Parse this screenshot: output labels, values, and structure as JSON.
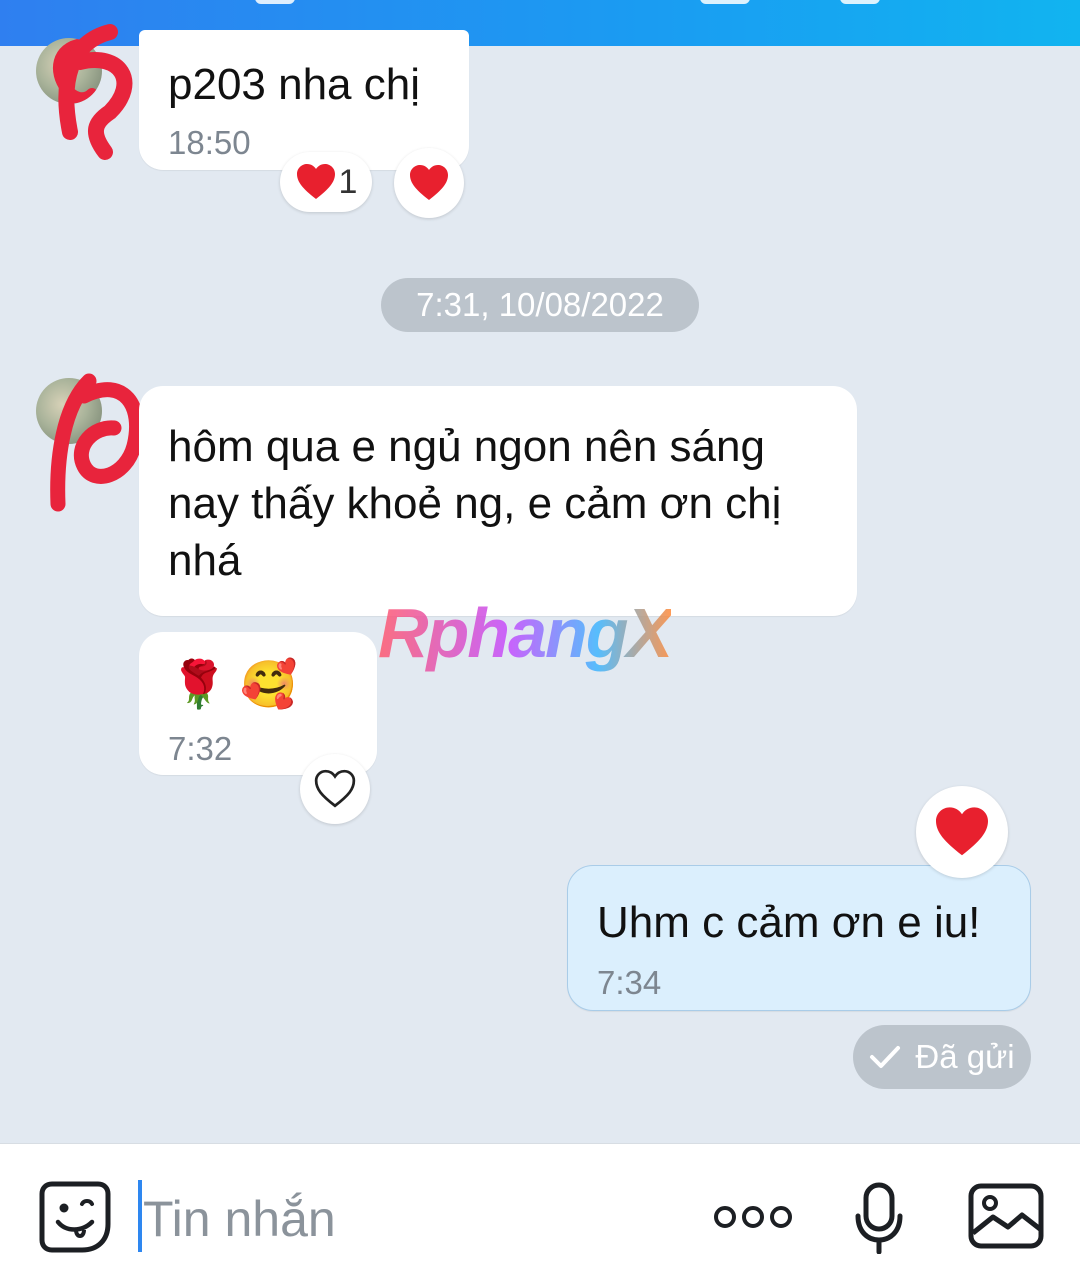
{
  "messages": [
    {
      "text": "p203 nha chị",
      "time": "18:50",
      "reactions": {
        "heart_count": "1"
      }
    },
    {
      "text": "hôm qua e ngủ ngon nên sáng\nnay thấy khoẻ ng, e cảm ơn chị\nnhá"
    },
    {
      "text": "🌹 🥰",
      "time": "7:32"
    },
    {
      "text": "Uhm c cảm ơn e iu!",
      "time": "7:34",
      "status": "Đã gửi"
    }
  ],
  "date_separator": "7:31, 10/08/2022",
  "watermark": "RphangX",
  "composer": {
    "placeholder": "Tin nhắn"
  },
  "colors": {
    "accent": "#1a9cf2",
    "my_bubble": "#dbeffd",
    "heart": "#e8202e",
    "background": "#e2e9f1"
  },
  "icons": [
    "sticker-icon",
    "more-options-icon",
    "microphone-icon",
    "image-icon",
    "heart-icon",
    "heart-outline-icon",
    "check-icon"
  ]
}
